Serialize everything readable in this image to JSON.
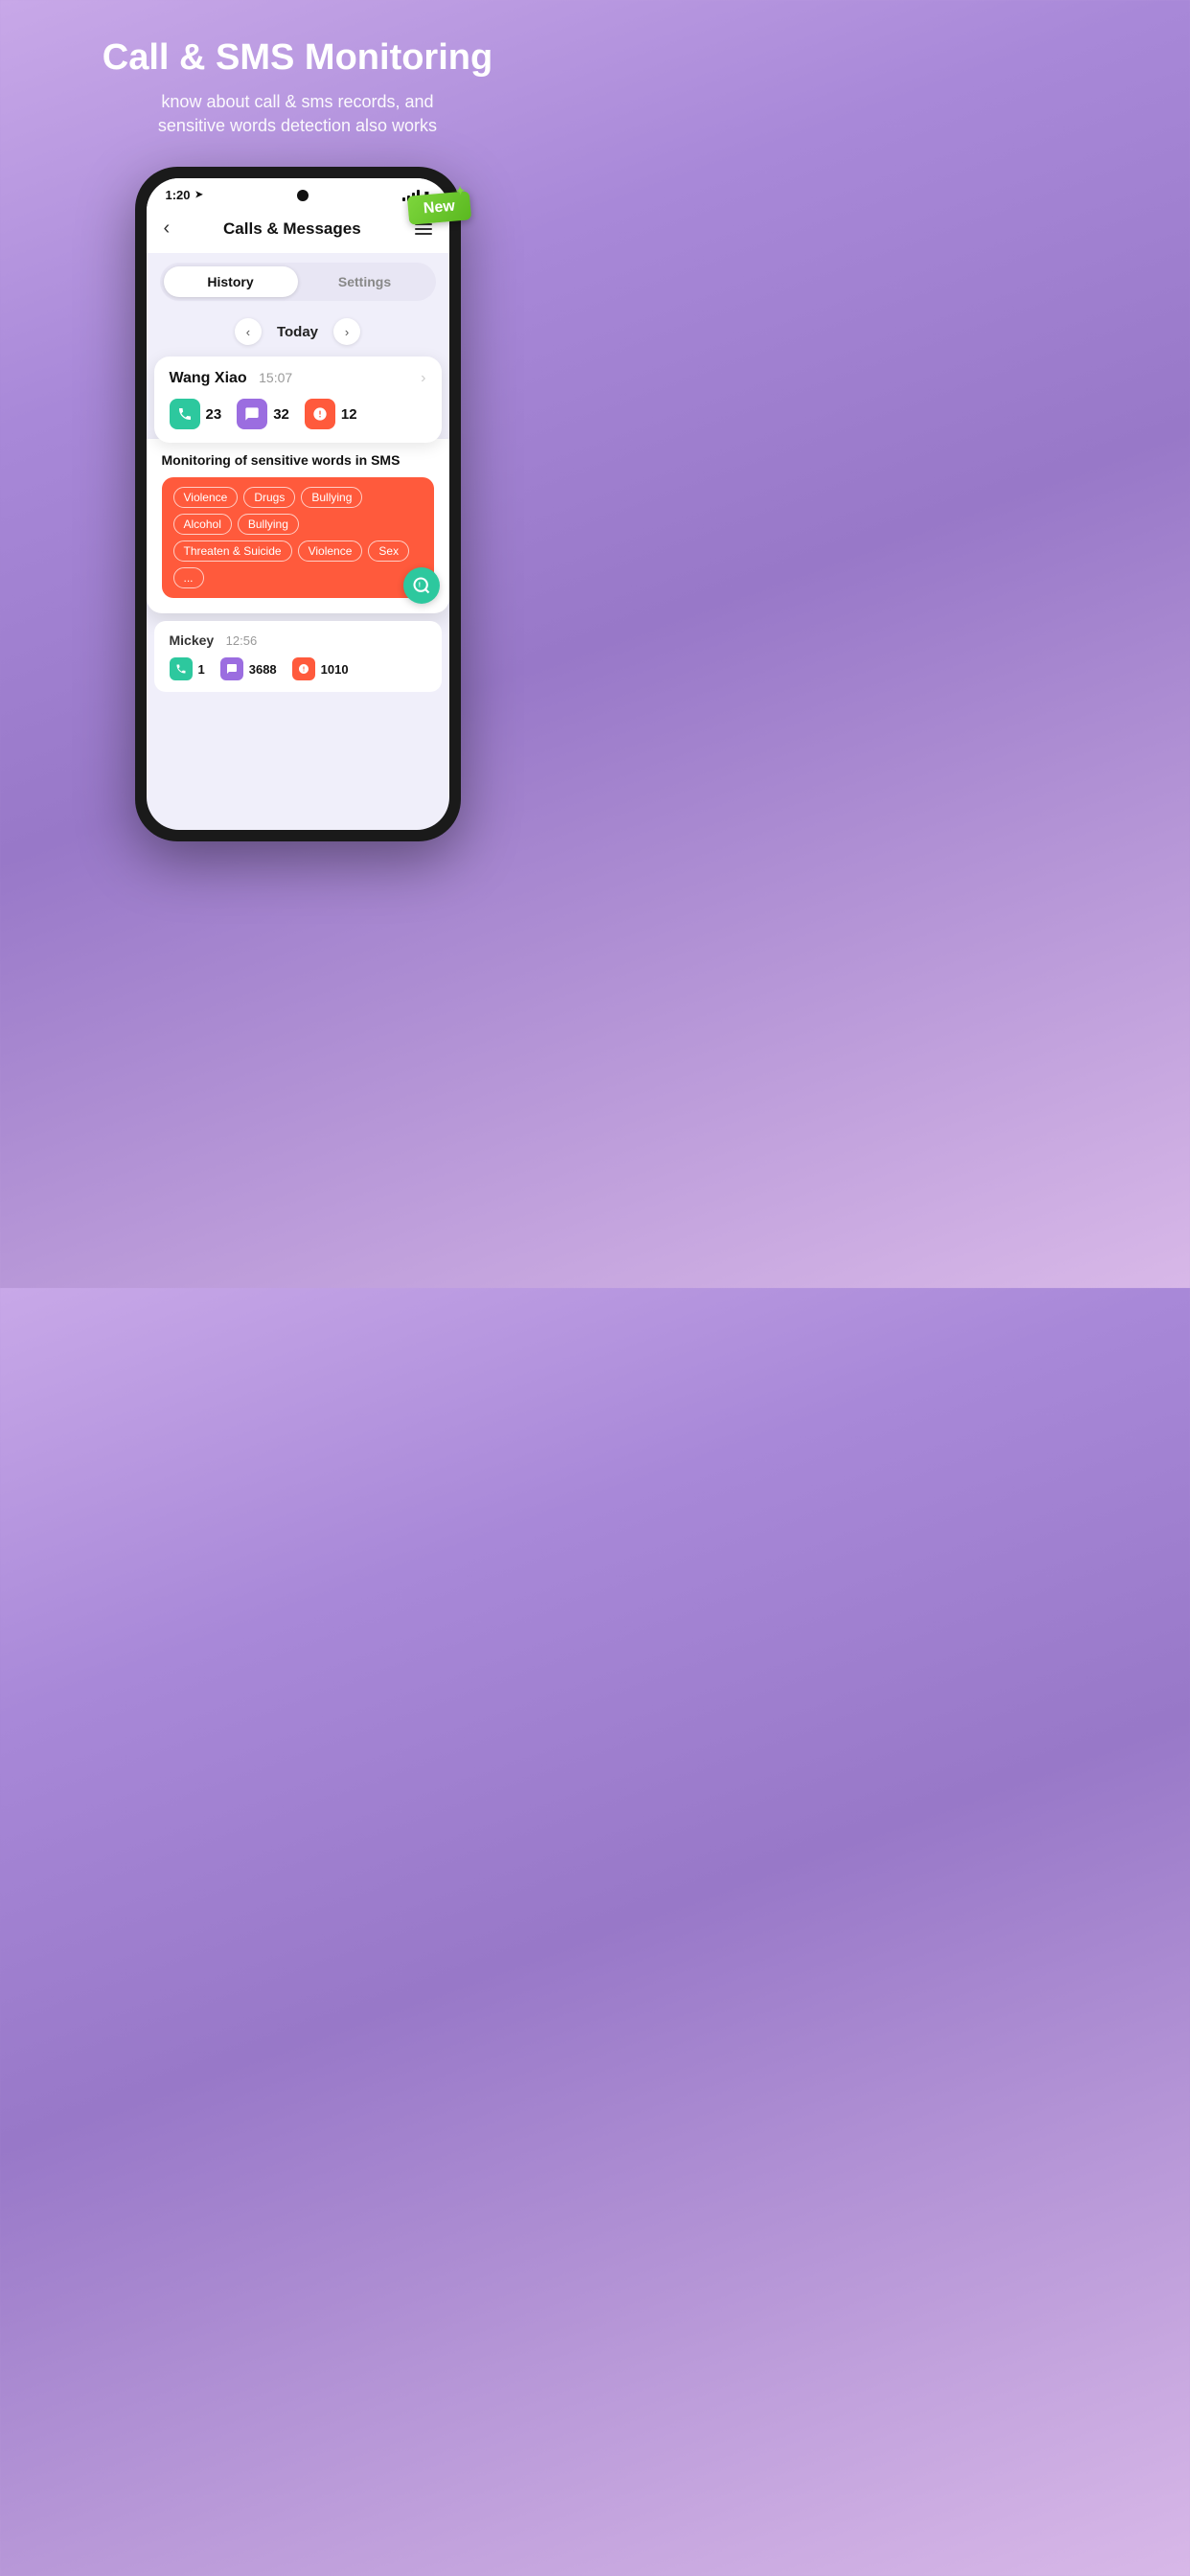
{
  "header": {
    "main_title": "Call & SMS Monitoring",
    "sub_title_line1": "know about call & sms records, and",
    "sub_title_line2": "sensitive words detection also works"
  },
  "badge": {
    "label": "New"
  },
  "status_bar": {
    "time": "1:20",
    "arrow": "➤"
  },
  "app_header": {
    "title": "Calls & Messages",
    "back": "‹",
    "menu": "≡"
  },
  "tabs": {
    "active": "History",
    "inactive": "Settings"
  },
  "date_nav": {
    "label": "Today",
    "prev": "‹",
    "next": "›"
  },
  "contact1": {
    "name": "Wang Xiao",
    "time": "15:07",
    "calls": "23",
    "messages": "32",
    "alerts": "12"
  },
  "sensitive_section": {
    "title": "Monitoring of sensitive words in SMS",
    "tags_row1": [
      "Violence",
      "Drugs",
      "Bullying",
      "Alcohol",
      "Bullying"
    ],
    "tags_row2": [
      "Threaten & Suicide",
      "Violence",
      "Sex",
      "..."
    ]
  },
  "contact2": {
    "name": "Mickey",
    "time": "12:56",
    "calls": "1",
    "messages": "3688",
    "alerts": "1010"
  }
}
